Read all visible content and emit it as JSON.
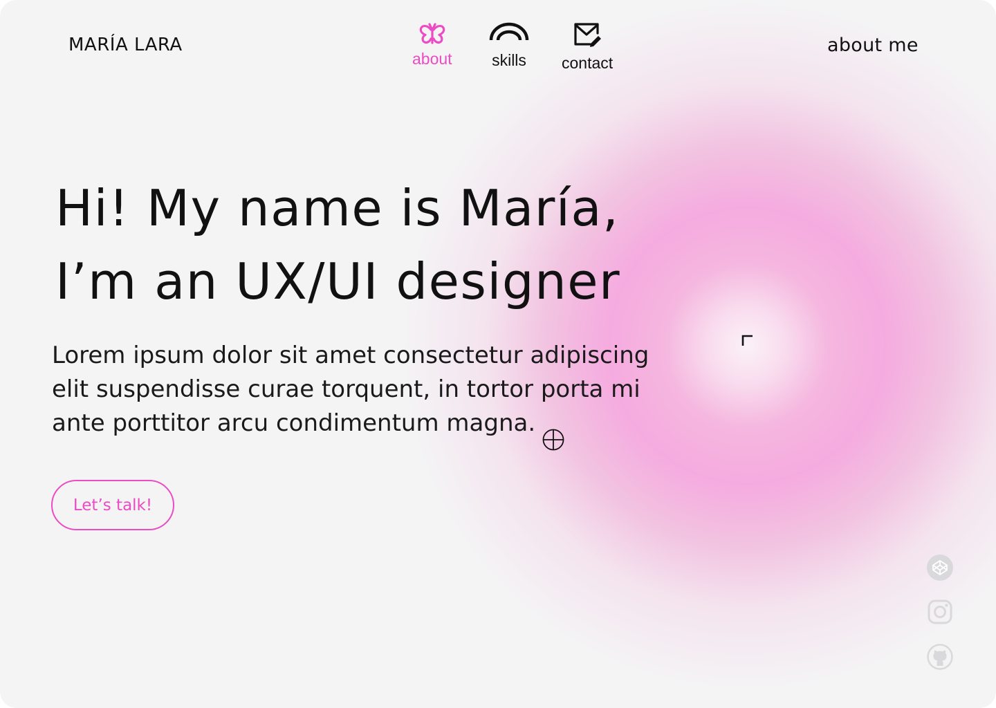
{
  "header": {
    "logo": "MARÍA LARA",
    "nav": [
      {
        "label": "about",
        "icon": "butterfly-icon",
        "active": true
      },
      {
        "label": "skills",
        "icon": "rainbow-arc-icon",
        "active": false
      },
      {
        "label": "contact",
        "icon": "mail-edit-icon",
        "active": false
      }
    ],
    "about_me": "about me"
  },
  "hero": {
    "headline_line1": "Hi! My name is María,",
    "headline_line2": "I’m an UX/UI designer",
    "body": "Lorem ipsum dolor sit amet consectetur adipiscing elit suspendisse curae torquent, in tortor porta mi ante porttitor arcu condimentum magna.",
    "cta_label": "Let’s talk!"
  },
  "socials": [
    {
      "icon": "codepen-icon"
    },
    {
      "icon": "instagram-icon"
    },
    {
      "icon": "github-icon"
    }
  ],
  "colors": {
    "accent": "#ec4bc3",
    "background": "#f4f4f5",
    "glow": "#f5abdf",
    "text": "#111111",
    "social_icon": "#d9d9dc"
  }
}
